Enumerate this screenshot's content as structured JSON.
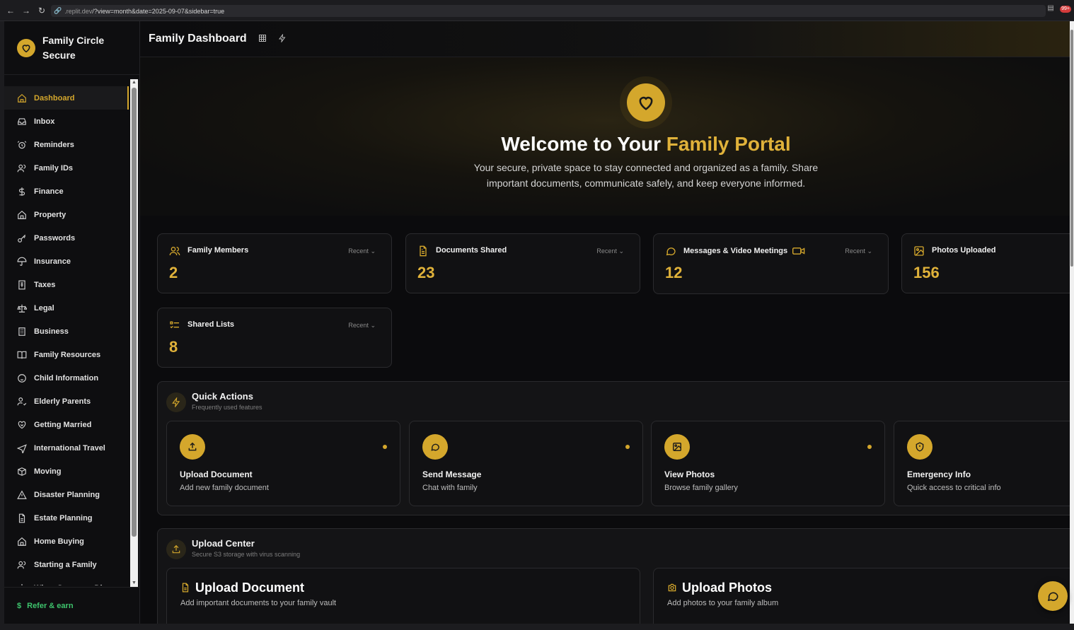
{
  "browser": {
    "url_host": ".replit.dev",
    "url_path": "/?view=month&date=2025-09-07&sidebar=true",
    "badge": "99+"
  },
  "brand": {
    "title": "Family Circle Secure"
  },
  "sidebar": {
    "items": [
      {
        "label": "Dashboard",
        "icon": "home-icon"
      },
      {
        "label": "Inbox",
        "icon": "inbox-icon"
      },
      {
        "label": "Reminders",
        "icon": "alarm-icon"
      },
      {
        "label": "Family IDs",
        "icon": "users-icon"
      },
      {
        "label": "Finance",
        "icon": "dollar-icon"
      },
      {
        "label": "Property",
        "icon": "house-icon"
      },
      {
        "label": "Passwords",
        "icon": "key-icon"
      },
      {
        "label": "Insurance",
        "icon": "umbrella-icon"
      },
      {
        "label": "Taxes",
        "icon": "receipt-icon"
      },
      {
        "label": "Legal",
        "icon": "scale-icon"
      },
      {
        "label": "Business",
        "icon": "building-icon"
      },
      {
        "label": "Family Resources",
        "icon": "book-icon"
      },
      {
        "label": "Child Information",
        "icon": "baby-icon"
      },
      {
        "label": "Elderly Parents",
        "icon": "user-check-icon"
      },
      {
        "label": "Getting Married",
        "icon": "heart-handshake-icon"
      },
      {
        "label": "International Travel",
        "icon": "plane-icon"
      },
      {
        "label": "Moving",
        "icon": "box-icon"
      },
      {
        "label": "Disaster Planning",
        "icon": "warning-icon"
      },
      {
        "label": "Estate Planning",
        "icon": "file-icon"
      },
      {
        "label": "Home Buying",
        "icon": "house-icon"
      },
      {
        "label": "Starting a Family",
        "icon": "users-icon"
      },
      {
        "label": "When Someone Dies",
        "icon": "flower-icon"
      }
    ],
    "refer": "Refer & earn"
  },
  "header": {
    "title": "Family Dashboard"
  },
  "hero": {
    "title_pre": "Welcome to Your ",
    "title_gold": "Family Portal",
    "subtitle": "Your secure, private space to stay connected and organized as a family. Share important documents, communicate safely, and keep everyone informed."
  },
  "stats": [
    {
      "label": "Family Members",
      "value": "2",
      "recent": "Recent",
      "icon": "users-icon"
    },
    {
      "label": "Documents Shared",
      "value": "23",
      "recent": "Recent",
      "icon": "document-icon"
    },
    {
      "label": "Messages  &  Video Meetings",
      "value": "12",
      "recent": "Recent",
      "icon": "chat-icon"
    },
    {
      "label": "Photos Uploaded",
      "value": "156",
      "recent": "",
      "icon": "image-icon"
    },
    {
      "label": "Shared Lists",
      "value": "8",
      "recent": "Recent",
      "icon": "list-icon"
    }
  ],
  "quick_actions": {
    "title": "Quick Actions",
    "subtitle": "Frequently used features",
    "items": [
      {
        "title": "Upload Document",
        "subtitle": "Add new family document",
        "icon": "upload-icon"
      },
      {
        "title": "Send Message",
        "subtitle": "Chat with family",
        "icon": "chat-icon"
      },
      {
        "title": "View Photos",
        "subtitle": "Browse family gallery",
        "icon": "image-icon"
      },
      {
        "title": "Emergency Info",
        "subtitle": "Quick access to critical info",
        "icon": "shield-icon"
      }
    ]
  },
  "upload_center": {
    "title": "Upload Center",
    "subtitle": "Secure S3 storage with virus scanning",
    "items": [
      {
        "title": "Upload Document",
        "subtitle": "Add important documents to your family vault",
        "icon": "document-icon"
      },
      {
        "title": "Upload Photos",
        "subtitle": "Add photos to your family album",
        "icon": "camera-icon"
      }
    ]
  },
  "colors": {
    "accent": "#d4a72c",
    "background": "#0b0b0d",
    "card": "#111113",
    "refer": "#3ec46d"
  }
}
